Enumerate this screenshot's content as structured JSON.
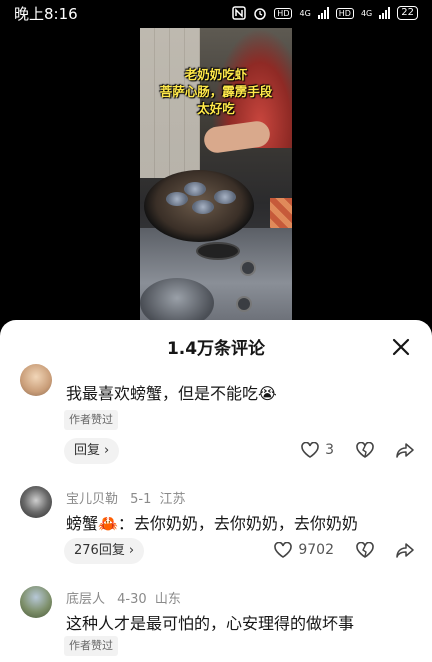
{
  "status_bar": {
    "time": "晚上8:16",
    "battery": "22",
    "network_1": "4G",
    "network_2": "4G",
    "hd_1": "HD",
    "hd_2": "HD"
  },
  "video": {
    "caption_line1": "老奶奶吃虾",
    "caption_line2": "菩萨心肠，霹雳手段",
    "caption_line3": "太好吃"
  },
  "comments_sheet": {
    "title": "1.4万条评论",
    "comments": [
      {
        "text": "我最喜欢螃蟹，但是不能吃😭",
        "author_badge": "作者赞过",
        "reply_label": "回复",
        "likes": "3"
      },
      {
        "username": "宝儿贝勒",
        "date": "5-1",
        "location": "江苏",
        "text": "螃蟹🦀：去你奶奶，去你奶奶，去你奶奶",
        "reply_label": "276回复",
        "likes": "9702"
      },
      {
        "username": "底层人",
        "date": "4-30",
        "location": "山东",
        "text": "这种人才是最可怕的，心安理得的做坏事",
        "author_badge": "作者赞过"
      }
    ]
  },
  "colors": {
    "caption_yellow": "#ffe94a",
    "sheet_bg": "#ffffff",
    "meta_gray": "#8a8a8a"
  }
}
